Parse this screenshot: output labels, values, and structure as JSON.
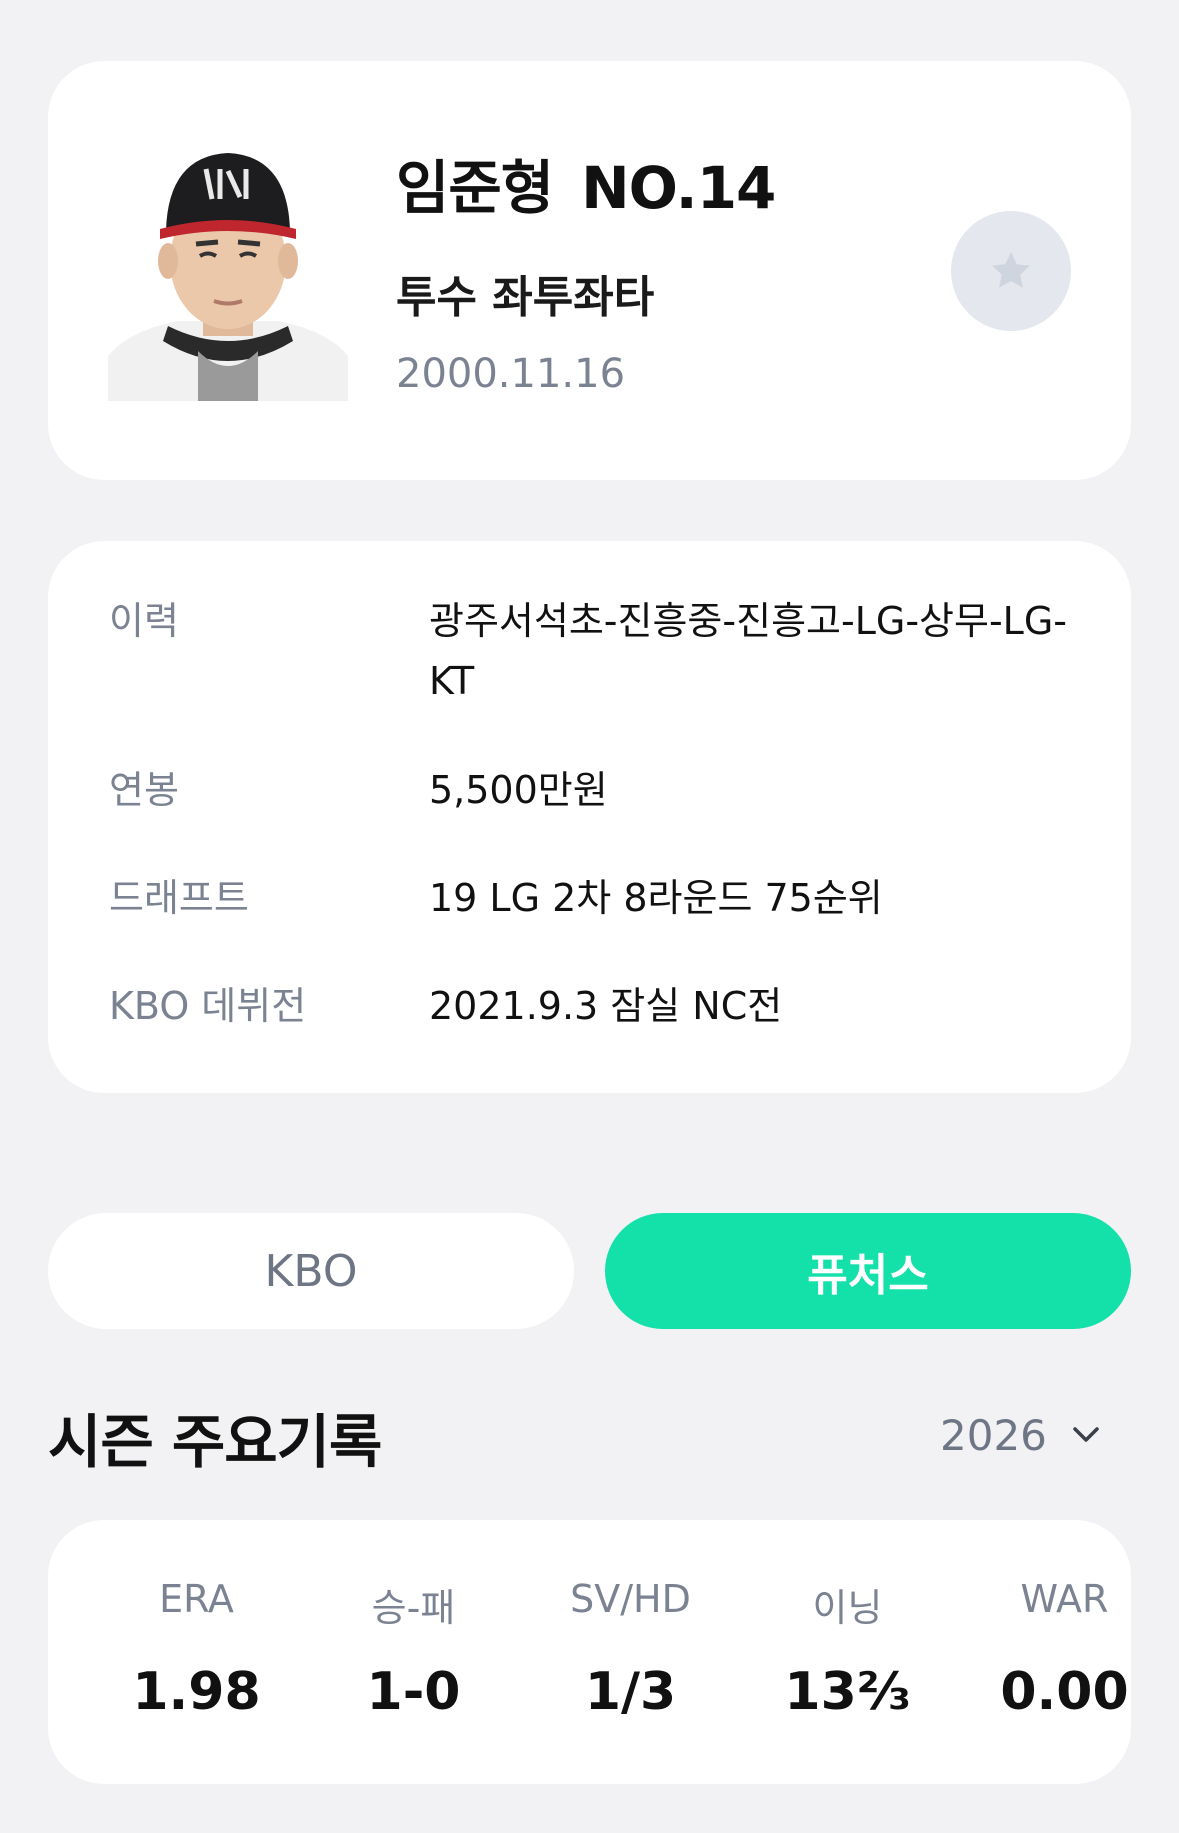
{
  "profile": {
    "name": "임준형",
    "number": "NO.14",
    "position_info": "투수 좌투좌타",
    "birth_date": "2000.11.16"
  },
  "info": {
    "rows": [
      {
        "label": "이력",
        "value": "광주서석초-진흥중-진흥고-LG-상무-LG-KT"
      },
      {
        "label": "연봉",
        "value": "5,500만원"
      },
      {
        "label": "드래프트",
        "value": "19 LG 2차 8라운드 75순위"
      },
      {
        "label": "KBO 데뷔전",
        "value": "2021.9.3 잠실 NC전"
      }
    ]
  },
  "tabs": [
    {
      "label": "KBO",
      "active": false
    },
    {
      "label": "퓨처스",
      "active": true
    }
  ],
  "season": {
    "title": "시즌 주요기록",
    "year": "2026"
  },
  "stats": [
    {
      "label": "ERA",
      "value": "1.98"
    },
    {
      "label": "승-패",
      "value": "1-0"
    },
    {
      "label": "SV/HD",
      "value": "1/3"
    },
    {
      "label": "이닝",
      "value": "13⅔"
    },
    {
      "label": "WAR",
      "value": "0.00"
    }
  ],
  "colors": {
    "background": "#f2f2f4",
    "accent": "#14e0aa",
    "muted_text": "#7b8291",
    "favorite_button": "#e4e7ed"
  },
  "icons": {
    "favorite": "star-icon",
    "year_dropdown": "chevron-down-icon"
  }
}
